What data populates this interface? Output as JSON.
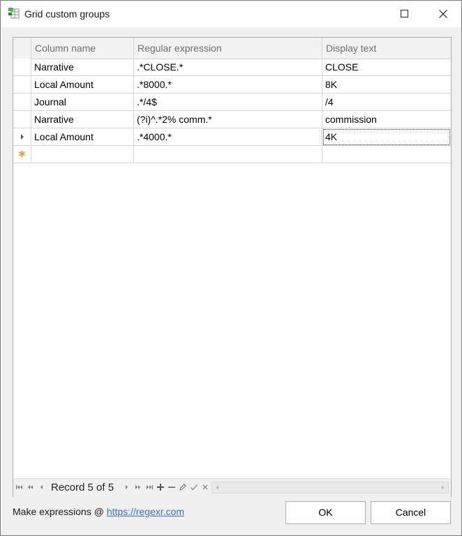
{
  "window": {
    "title": "Grid custom groups"
  },
  "grid": {
    "columns": [
      "Column name",
      "Regular expression",
      "Display text"
    ],
    "rows": [
      {
        "column_name": "Narrative",
        "regex": ".*CLOSE.*",
        "display": "CLOSE"
      },
      {
        "column_name": "Local Amount",
        "regex": ".*8000.*",
        "display": "8K"
      },
      {
        "column_name": "Journal",
        "regex": ".*/4$",
        "display": "/4"
      },
      {
        "column_name": "Narrative",
        "regex": "(?i)^.*2% comm.*",
        "display": "commission"
      },
      {
        "column_name": "Local Amount",
        "regex": ".*4000.*",
        "display": "4K"
      }
    ],
    "current_row_index": 4,
    "new_row_marker": "✱"
  },
  "navigator": {
    "record_text": "Record 5 of 5"
  },
  "footer": {
    "hint_prefix": "Make expressions @ ",
    "hint_link": "https://regexr.com",
    "ok_label": "OK",
    "cancel_label": "Cancel"
  },
  "colors": {
    "link": "#3a6fb3",
    "new_row_star": "#e8a33c",
    "grid_line": "#d4d4d4"
  }
}
